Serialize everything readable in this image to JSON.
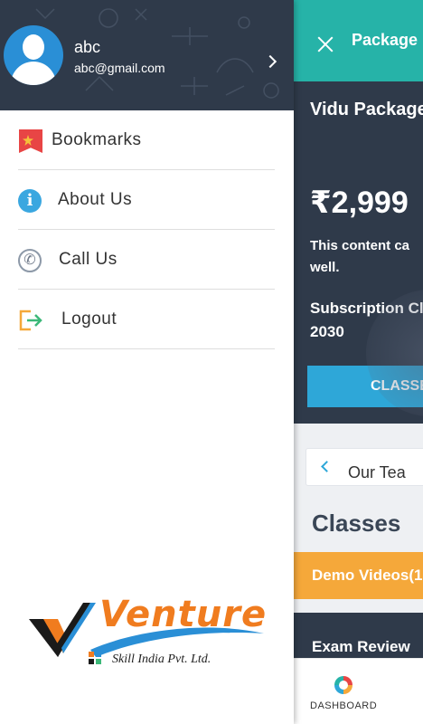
{
  "app": {
    "topbar_title": "Package",
    "package_name": "Vidu Package",
    "price": "₹2,999",
    "description": "This content ca well.",
    "subscription_closing": "Subscription Clo 2030",
    "classes_button": "CLASSE",
    "teacher_card": "Our Tea",
    "classes_heading": "Classes",
    "demo_videos": "Demo Videos(1",
    "exam_review": "Exam Review",
    "dashboard_label": "DASHBOARD"
  },
  "drawer": {
    "user": {
      "name": "abc",
      "email": "abc@gmail.com"
    },
    "menu": [
      {
        "label": "Bookmarks",
        "icon": "bookmark-icon"
      },
      {
        "label": "About Us",
        "icon": "info-icon"
      },
      {
        "label": "Call Us",
        "icon": "phone-icon"
      },
      {
        "label": "Logout",
        "icon": "logout-icon"
      }
    ],
    "logo": {
      "title": "Venture",
      "subtitle": "Skill India Pvt. Ltd."
    }
  },
  "colors": {
    "header_bg": "#2f3a4a",
    "accent_teal": "#26b3a8",
    "accent_blue": "#2ea7d8",
    "accent_orange": "#f5a83a"
  }
}
